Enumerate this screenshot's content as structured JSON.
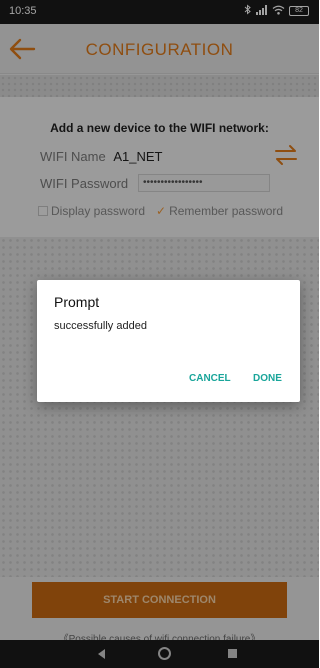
{
  "status_bar": {
    "time": "10:35",
    "battery": "82"
  },
  "header": {
    "title": "CONFIGURATION",
    "accent_color": "#e07a1a"
  },
  "form": {
    "title": "Add a new device to the WIFI network:",
    "wifi_name_label": "WIFI Name",
    "wifi_name_value": "A1_NET",
    "wifi_password_label": "WIFI Password",
    "wifi_password_value": "•••••••••••••••••",
    "display_password_label": "Display password",
    "display_password_checked": false,
    "remember_password_label": "Remember password",
    "remember_password_checked": true
  },
  "bottom": {
    "start_button": "START CONNECTION",
    "failure_link": "《Possible causes of wifi connection failure》",
    "button_color": "#c96a12"
  },
  "dialog": {
    "title": "Prompt",
    "message": "successfully added",
    "cancel_label": "CANCEL",
    "done_label": "DONE",
    "action_color": "#19a59a"
  },
  "icons": {
    "back": "arrow-left-icon",
    "swap": "swap-arrows-icon",
    "bluetooth": "bluetooth-icon",
    "signal": "signal-icon",
    "wifi": "wifi-icon",
    "battery": "battery-icon"
  }
}
